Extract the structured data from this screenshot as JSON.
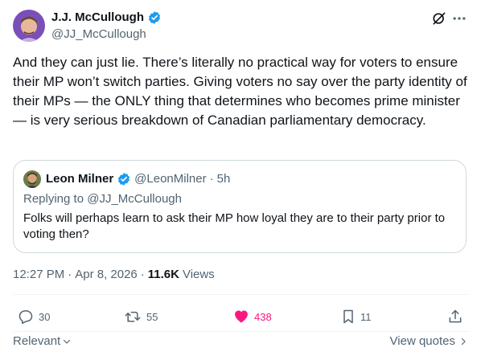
{
  "author": {
    "name": "J.J. McCullough",
    "handle": "@JJ_McCullough",
    "verified_color": "#1d9bf0"
  },
  "tweet": {
    "text": "And they can just lie. There’s literally no practical way for voters to ensure their MP won’t switch parties. Giving voters no say over the party identity of their MPs — the ONLY thing that determines who becomes prime minister — is very serious breakdown of Canadian parliamentary democracy."
  },
  "quote": {
    "name": "Leon Milner",
    "handle": "@LeonMilner",
    "dot": "·",
    "time": "5h",
    "replying": "Replying to @JJ_McCullough",
    "text": "Folks will perhaps learn to ask their MP how loyal they are to their party prior to voting then?"
  },
  "meta": {
    "time": "12:27 PM",
    "sep1": "·",
    "date": "Apr 8, 2026",
    "sep2": "·",
    "views_count": "11.6K",
    "views_label": "Views"
  },
  "actions": {
    "replies": "30",
    "reposts": "55",
    "likes": "438",
    "bookmarks": "11"
  },
  "bottom": {
    "sort_label": "Relevant",
    "view_quotes": "View quotes"
  },
  "colors": {
    "like": "#f91880",
    "secondary": "#536471",
    "border": "#cfd9de",
    "verified": "#1d9bf0"
  }
}
